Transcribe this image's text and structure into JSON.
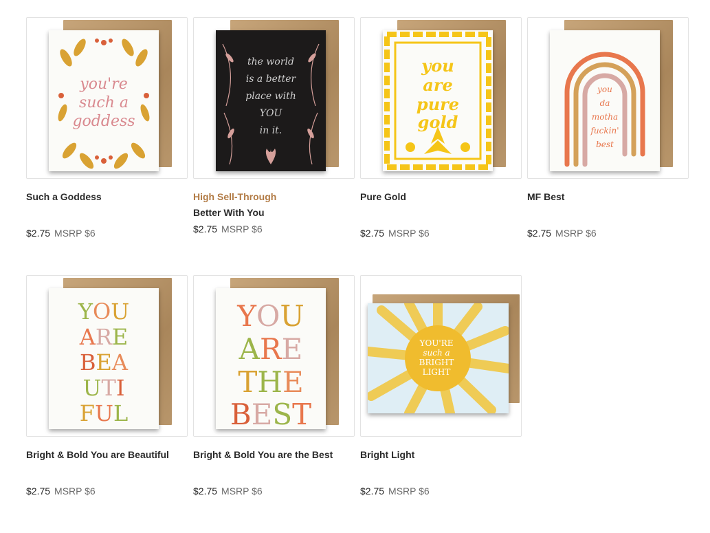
{
  "products": [
    {
      "title": "Such a Goddess",
      "badge": "",
      "price": "$2.75",
      "msrp": "MSRP $6",
      "card_text": "you're such a goddess"
    },
    {
      "title": "Better With You",
      "badge": "High Sell-Through",
      "price": "$2.75",
      "msrp": "MSRP $6",
      "card_text": "the world is a better place with YOU in it."
    },
    {
      "title": "Pure Gold",
      "badge": "",
      "price": "$2.75",
      "msrp": "MSRP $6",
      "card_text": "you are pure gold"
    },
    {
      "title": "MF Best",
      "badge": "",
      "price": "$2.75",
      "msrp": "MSRP $6",
      "card_text": "you da motha fuckin' best"
    },
    {
      "title": "Bright & Bold You are Beautiful",
      "badge": "",
      "price": "$2.75",
      "msrp": "MSRP $6",
      "card_text": "YOU ARE BEA UTI FUL"
    },
    {
      "title": "Bright & Bold You are the Best",
      "badge": "",
      "price": "$2.75",
      "msrp": "MSRP $6",
      "card_text": "YOU ARE THE BEST"
    },
    {
      "title": "Bright Light",
      "badge": "",
      "price": "$2.75",
      "msrp": "MSRP $6",
      "card_text": "YOU'RE such a BRIGHT LIGHT"
    }
  ],
  "colors": {
    "badge": "#b27b45",
    "text": "#2b2b2b",
    "muted": "#6b6b6b",
    "border": "#e2e2e2"
  }
}
